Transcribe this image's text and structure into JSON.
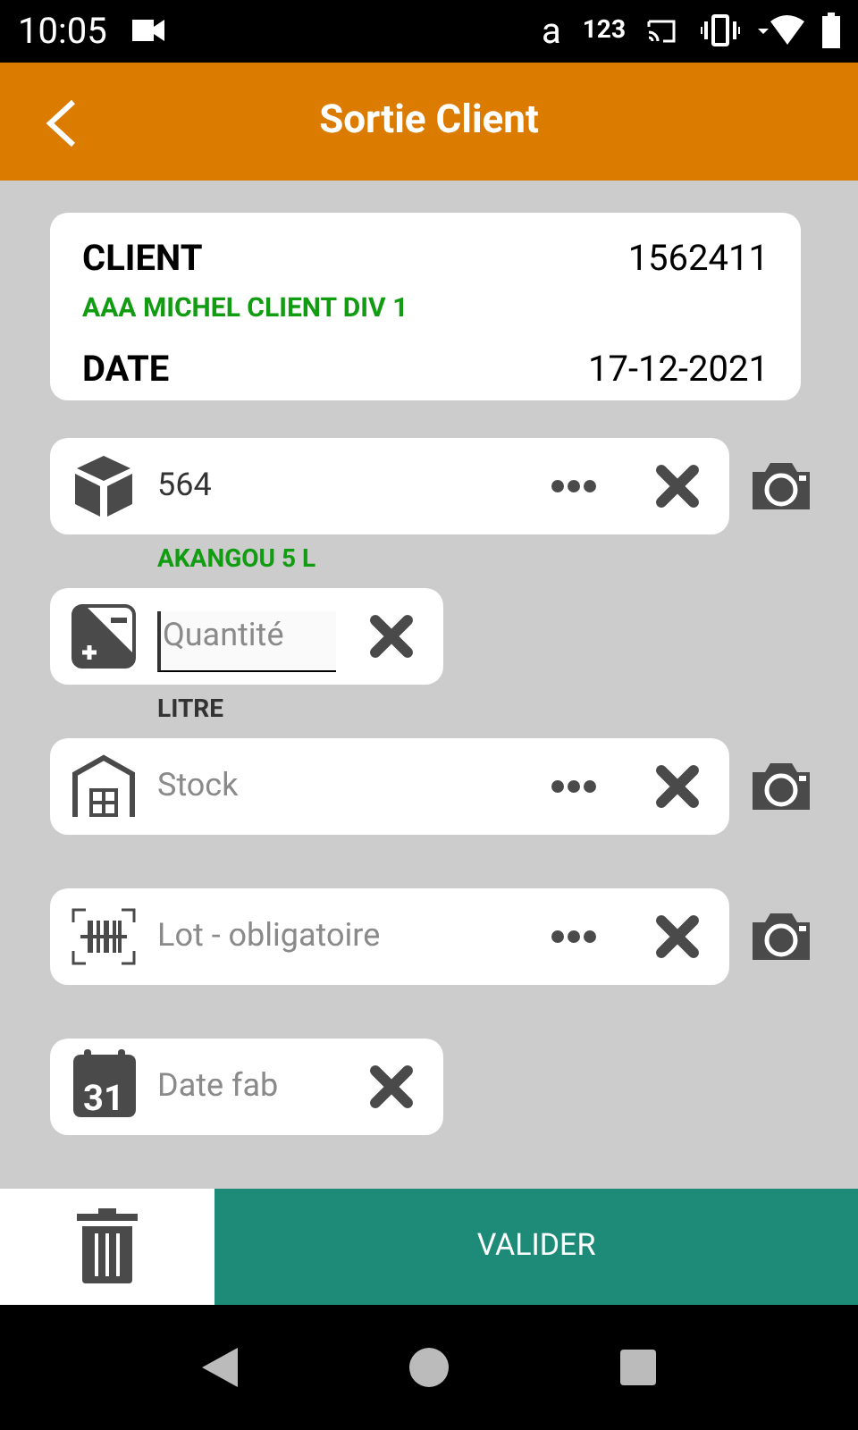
{
  "status_bar": {
    "time": "10:05",
    "indicators": [
      "a",
      "123"
    ]
  },
  "header": {
    "title": "Sortie Client"
  },
  "client_card": {
    "rows": [
      {
        "label": "CLIENT",
        "value": "1562411"
      },
      {
        "label": "DATE",
        "value": "17-12-2021"
      }
    ],
    "client_name": "AAA MICHEL CLIENT DIV 1"
  },
  "fields": [
    {
      "kind": "wide",
      "value": "564",
      "caption": "AKANGOU 5 L",
      "color": "#119c11",
      "focused": false
    },
    {
      "kind": "short",
      "placeholder": "Quantité",
      "caption": "LITRE",
      "color": "#333333",
      "focused": true
    },
    {
      "kind": "wide",
      "placeholder": "Stock",
      "focused": false
    },
    {
      "kind": "wide",
      "placeholder": "Lot - obligatoire",
      "focused": false
    },
    {
      "kind": "short",
      "icon_label": "31",
      "placeholder": "Date fab",
      "focused": false
    }
  ],
  "bottom_bar": {
    "button": "VALIDER"
  }
}
